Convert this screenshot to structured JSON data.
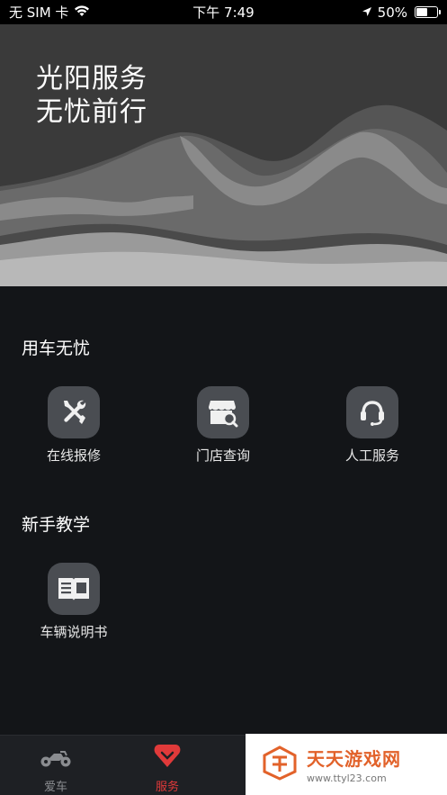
{
  "status_bar": {
    "carrier": "无 SIM 卡",
    "time": "下午 7:49",
    "battery_text": "50%",
    "battery_level": 0.5
  },
  "hero": {
    "line1": "光阳服务",
    "line2": "无忧前行"
  },
  "sections": {
    "worry_free": {
      "title": "用车无忧",
      "items": [
        {
          "label": "在线报修",
          "icon": "tools-icon"
        },
        {
          "label": "门店查询",
          "icon": "store-search-icon"
        },
        {
          "label": "人工服务",
          "icon": "headset-icon"
        }
      ]
    },
    "tutorial": {
      "title": "新手教学",
      "items": [
        {
          "label": "车辆说明书",
          "icon": "manual-book-icon"
        }
      ]
    }
  },
  "tabbar": {
    "tabs": [
      {
        "label": "爱车",
        "icon": "motorcycle-icon",
        "active": false
      },
      {
        "label": "服务",
        "icon": "service-heart-icon",
        "active": true
      }
    ],
    "active_color": "#e03a3a",
    "inactive_color": "#8a8c90"
  },
  "watermark": {
    "title": "天天游戏网",
    "url": "www.ttyl23.com"
  }
}
